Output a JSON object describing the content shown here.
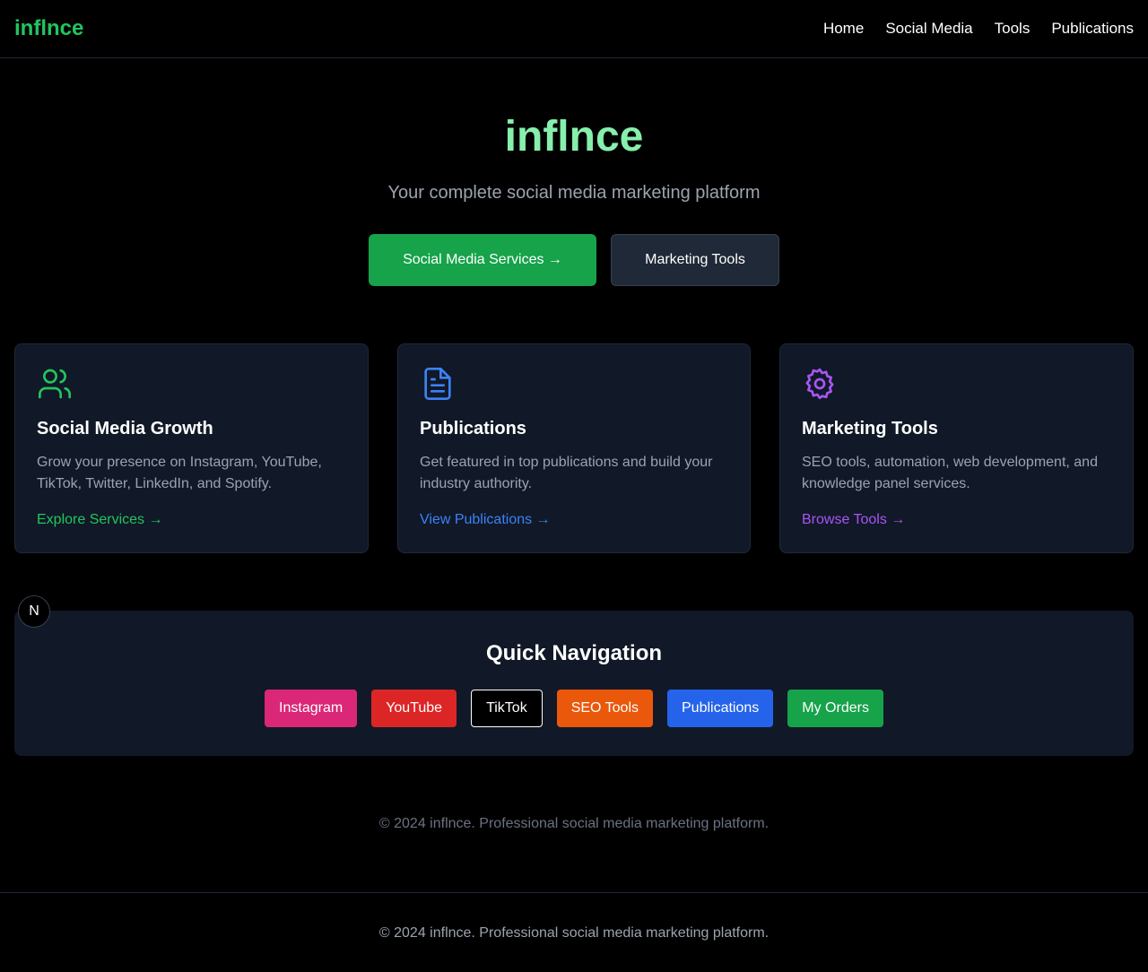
{
  "header": {
    "brand": "inflnce",
    "nav": [
      "Home",
      "Social Media",
      "Tools",
      "Publications"
    ]
  },
  "hero": {
    "title": "inflnce",
    "subtitle": "Your complete social media marketing platform",
    "primary_button": "Social Media Services →",
    "secondary_button": "Marketing Tools"
  },
  "cards": [
    {
      "icon": "users-icon",
      "title": "Social Media Growth",
      "desc": "Grow your presence on Instagram, YouTube, TikTok, Twitter, LinkedIn, and Spotify.",
      "link": "Explore Services →",
      "color": "#22c55e"
    },
    {
      "icon": "document-icon",
      "title": "Publications",
      "desc": "Get featured in top publications and build your industry authority.",
      "link": "View Publications →",
      "color": "#3b82f6"
    },
    {
      "icon": "gear-icon",
      "title": "Marketing Tools",
      "desc": "SEO tools, automation, web development, and knowledge panel services.",
      "link": "Browse Tools →",
      "color": "#a855f7"
    }
  ],
  "badge": "N",
  "quick_nav": {
    "title": "Quick Navigation",
    "buttons": [
      {
        "label": "Instagram",
        "color": "#db2777"
      },
      {
        "label": "YouTube",
        "color": "#dc2626"
      },
      {
        "label": "TikTok",
        "color": "#000000"
      },
      {
        "label": "SEO Tools",
        "color": "#ea580c"
      },
      {
        "label": "Publications",
        "color": "#2563eb"
      },
      {
        "label": "My Orders",
        "color": "#16a34a"
      }
    ]
  },
  "copyright": "© 2024 inflnce. Professional social media marketing platform.",
  "footer": {
    "copyright": "© 2024 inflnce. Professional social media marketing platform."
  }
}
